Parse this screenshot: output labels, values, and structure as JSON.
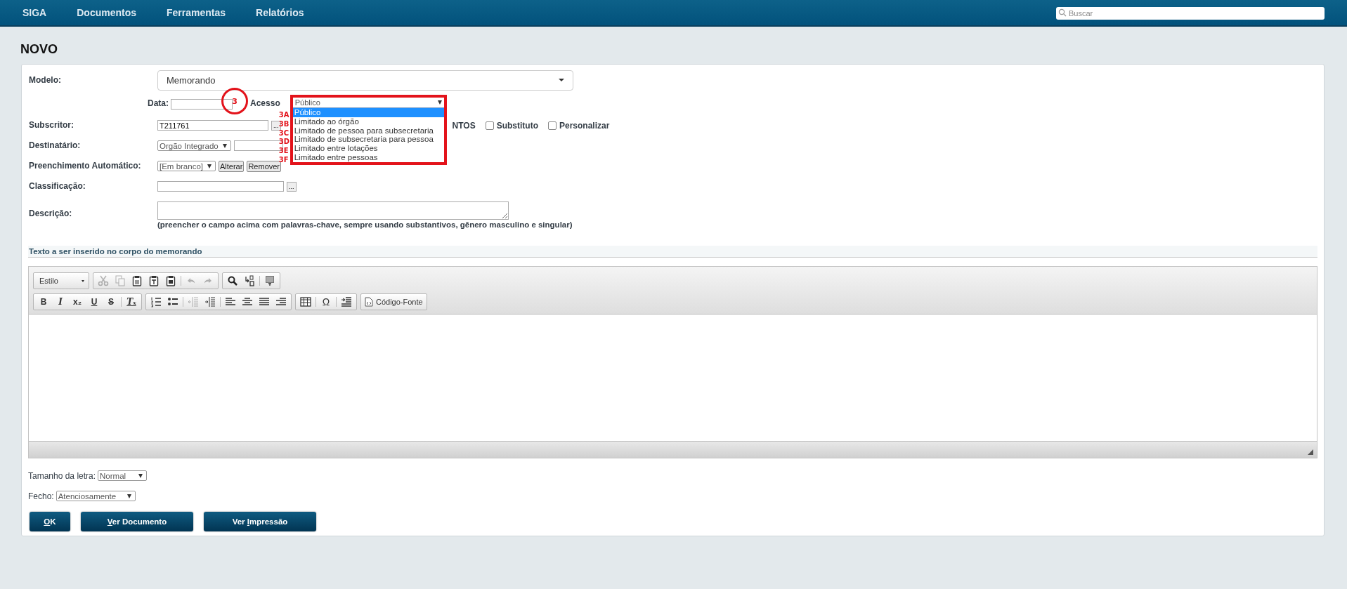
{
  "nav": {
    "items": [
      {
        "label": "SIGA"
      },
      {
        "label": "Documentos"
      },
      {
        "label": "Ferramentas"
      },
      {
        "label": "Relatórios"
      }
    ],
    "search": {
      "placeholder": "Buscar"
    }
  },
  "page_title": "NOVO",
  "form": {
    "modelo": {
      "label": "Modelo:",
      "value": "Memorando"
    },
    "data": {
      "label": "Data:"
    },
    "acesso": {
      "label": "Acesso",
      "value": "Público",
      "options": [
        {
          "label": "Público",
          "selected": true
        },
        {
          "label": "Limitado ao órgão",
          "selected": false
        },
        {
          "label": "Limitado de pessoa para subsecretaria",
          "selected": false
        },
        {
          "label": "Limitado de subsecretaria para pessoa",
          "selected": false
        },
        {
          "label": "Limitado entre lotações",
          "selected": false
        },
        {
          "label": "Limitado entre pessoas",
          "selected": false
        }
      ]
    },
    "subscritor": {
      "label": "Subscritor:",
      "value": "T211761",
      "browse": "...",
      "partial_text": "NTOS",
      "checkboxes": [
        {
          "label": "Substituto",
          "checked": false
        },
        {
          "label": "Personalizar",
          "checked": false
        }
      ]
    },
    "destinatario": {
      "label": "Destinatário:",
      "type_select": "Orgão Integrado"
    },
    "preenchimento": {
      "label": "Preenchimento Automático:",
      "select": "[Em branco]",
      "buttons": [
        "Alterar",
        "Remover"
      ]
    },
    "classificacao": {
      "label": "Classificação:",
      "browse": "..."
    },
    "descricao": {
      "label": "Descrição:",
      "hint": "(preencher o campo acima com palavras-chave, sempre usando substantivos, gênero masculino e singular)"
    }
  },
  "editor": {
    "heading": "Texto a ser inserido no corpo do memorando",
    "toolbar": [
      [
        {
          "kind": "style-select",
          "label": "Estilo"
        }
      ],
      [
        {
          "kind": "cut",
          "disabled": true
        },
        {
          "kind": "copy",
          "disabled": true
        },
        {
          "kind": "paste",
          "disabled": false
        },
        {
          "kind": "paste-text",
          "disabled": false
        },
        {
          "kind": "paste-word",
          "disabled": false
        },
        {
          "kind": "sep"
        },
        {
          "kind": "undo",
          "disabled": true
        },
        {
          "kind": "redo",
          "disabled": true
        }
      ],
      [
        {
          "kind": "find",
          "disabled": false
        },
        {
          "kind": "replace",
          "disabled": false
        },
        {
          "kind": "sep"
        },
        {
          "kind": "blocks",
          "disabled": false
        }
      ],
      [
        {
          "kind": "break"
        }
      ],
      [
        {
          "kind": "bold",
          "glyph": "B",
          "disabled": false
        },
        {
          "kind": "italic",
          "glyph": "I",
          "disabled": false
        },
        {
          "kind": "subscript",
          "glyph": "x₂",
          "disabled": false
        },
        {
          "kind": "underline",
          "glyph": "U",
          "disabled": false
        },
        {
          "kind": "strike",
          "glyph": "S",
          "disabled": false
        },
        {
          "kind": "sep"
        },
        {
          "kind": "remove-format",
          "glyph": "Tₓ",
          "disabled": false
        }
      ],
      [
        {
          "kind": "ordered-list",
          "disabled": false
        },
        {
          "kind": "bullet-list",
          "disabled": false
        },
        {
          "kind": "sep"
        },
        {
          "kind": "outdent",
          "disabled": true
        },
        {
          "kind": "indent",
          "disabled": false
        },
        {
          "kind": "sep"
        },
        {
          "kind": "align-left",
          "disabled": false
        },
        {
          "kind": "align-center",
          "disabled": false
        },
        {
          "kind": "justify",
          "disabled": false
        },
        {
          "kind": "align-right",
          "disabled": false
        }
      ],
      [
        {
          "kind": "table",
          "disabled": false
        },
        {
          "kind": "sep"
        },
        {
          "kind": "special-char",
          "glyph": "Ω",
          "disabled": false
        },
        {
          "kind": "sep"
        },
        {
          "kind": "indent-block",
          "disabled": false
        }
      ],
      [
        {
          "kind": "source",
          "label": "Código-Fonte",
          "disabled": false
        }
      ]
    ]
  },
  "tamanho": {
    "label": "Tamanho da letra:",
    "value": "Normal"
  },
  "fecho": {
    "label": "Fecho:",
    "value": "Atenciosamente"
  },
  "buttons": [
    {
      "key": "O",
      "after": "K"
    },
    {
      "key": "V",
      "after": "er Documento"
    },
    {
      "before": "Ver ",
      "key": "I",
      "after": "mpressão"
    }
  ],
  "annotations": {
    "circle_label": "3",
    "option_labels": [
      "3A",
      "3B",
      "3C",
      "3D",
      "3E",
      "3F"
    ]
  }
}
